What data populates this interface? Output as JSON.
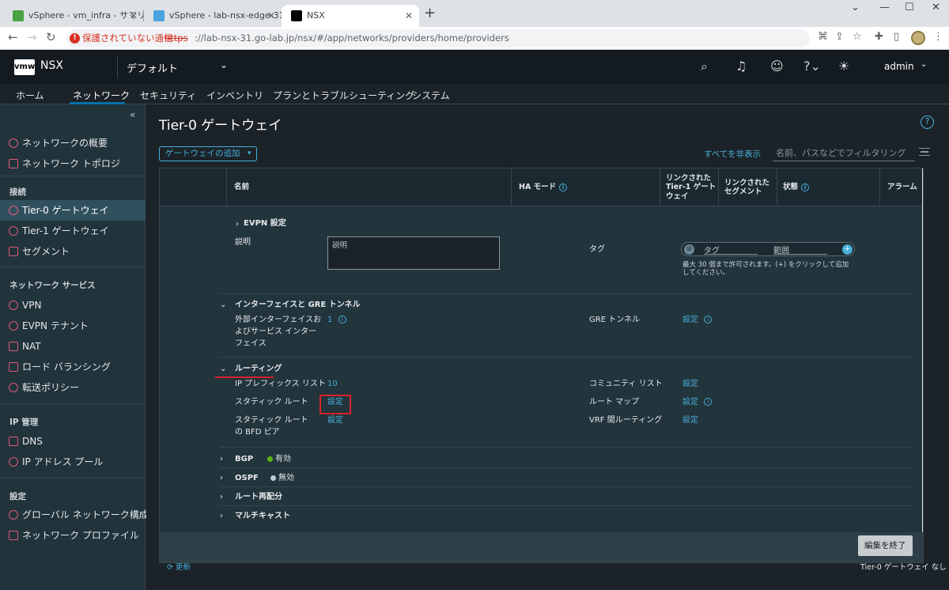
{
  "browser": {
    "tabs": [
      {
        "title": "vSphere - vm_infra - サマリ",
        "favicon_color": "#48a23f"
      },
      {
        "title": "vSphere - lab-nsx-edge-31 - サマ",
        "favicon_color": "#4aa3df"
      },
      {
        "title": "NSX",
        "favicon_color": "#000000"
      }
    ],
    "insecure_label": "保護されていない通信",
    "url_scheme": "https",
    "url_rest": "://lab-nsx-31.go-lab.jp/nsx/#/app/networks/providers/home/providers"
  },
  "header": {
    "logo": "vmw",
    "app_name": "NSX",
    "project": "デフォルト",
    "user": "admin"
  },
  "main_nav": [
    "ホーム",
    "ネットワーク",
    "セキュリティ",
    "インベントリ",
    "プランとトラブルシューティング",
    "システム"
  ],
  "sidebar": {
    "top_items": [
      "ネットワークの概要",
      "ネットワーク トポロジ"
    ],
    "connection_heading": "接続",
    "connection_items": [
      "Tier-0 ゲートウェイ",
      "Tier-1 ゲートウェイ",
      "セグメント"
    ],
    "network_services_heading": "ネットワーク サービス",
    "network_services_items": [
      "VPN",
      "EVPN テナント",
      "NAT",
      "ロード バランシング",
      "転送ポリシー"
    ],
    "ip_heading": "IP 管理",
    "ip_items": [
      "DNS",
      "IP アドレス プール"
    ],
    "settings_heading": "設定",
    "settings_items": [
      "グローバル ネットワーク構成",
      "ネットワーク プロファイル"
    ]
  },
  "page": {
    "title": "Tier-0 ゲートウェイ",
    "add_gateway": "ゲートウェイの追加",
    "hide_all": "すべてを非表示",
    "filter_placeholder": "名前、パスなどでフィルタリング"
  },
  "grid": {
    "headers": {
      "name": "名前",
      "ha_mode": "HA モード",
      "linked_tier1": "リンクされた Tier-1 ゲートウェイ",
      "linked_segment": "リンクされた セグメント",
      "status": "状態",
      "alarm": "アラーム"
    },
    "evpn": "EVPN 設定",
    "description_label": "説明",
    "description_placeholder": "説明",
    "tag_label": "タグ",
    "tag_placeholder": "タグ",
    "scope_placeholder": "範囲",
    "tag_note": "最大 30 個まで許可されます。(+) をクリックして追加してください。",
    "interfaces_section": "インターフェイスと GRE トンネル",
    "ext_if_label": "外部インターフェイスおよびサービス インターフェイス",
    "ext_if_value": "1",
    "gre_label": "GRE トンネル",
    "gre_value": "設定",
    "routing_section": "ルーティング",
    "ip_prefix_label": "IP プレフィックス リスト",
    "ip_prefix_value": "10",
    "community_label": "コミュニティ リスト",
    "community_value": "設定",
    "static_route_label": "スタティック ルート",
    "static_route_value": "設定",
    "route_map_label": "ルート マップ",
    "route_map_value": "設定",
    "bfd_label": "スタティック ルートの BFD ピア",
    "bfd_value": "設定",
    "vrf_label": "VRF 間ルーティング",
    "vrf_value": "設定",
    "bgp_label": "BGP",
    "bgp_status": "有効",
    "bgp_color": "#60b515",
    "ospf_label": "OSPF",
    "ospf_status": "無効",
    "ospf_color": "#c1cdd4",
    "redistribution_label": "ルート再配分",
    "multicast_label": "マルチキャスト",
    "finish_edit": "編集を終了"
  },
  "footer": {
    "refresh": "更新",
    "count": "Tier-0 ゲートウェイ なし"
  }
}
